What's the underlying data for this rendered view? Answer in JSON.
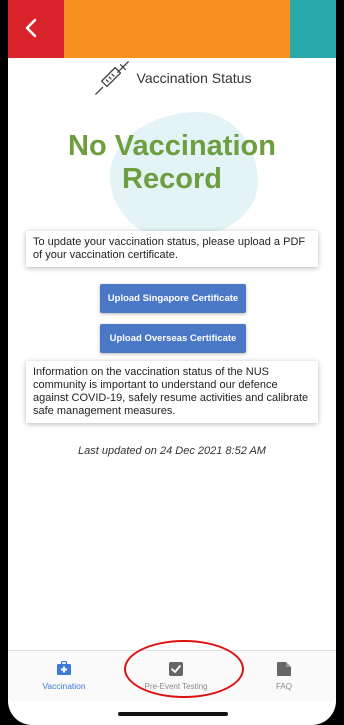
{
  "header": {
    "back_icon": "chevron-left-icon",
    "colors": {
      "left": "#d8232a",
      "middle": "#f7901e",
      "right": "#2aa9ad"
    }
  },
  "status": {
    "icon": "syringe-icon",
    "label": "Vaccination Status"
  },
  "record": {
    "title_line1": "No Vaccination",
    "title_line2": "Record",
    "title_color": "#6d9e3f"
  },
  "upload_info": "To update your vaccination status, please upload a PDF of your vaccination certificate.",
  "buttons": {
    "upload_singapore": "Upload Singapore Certificate",
    "upload_overseas": "Upload Overseas Certificate",
    "color": "#4a78c7"
  },
  "info_text": "Information on the vaccination status of the NUS community is important to understand our defence against COVID-19, safely resume activities and calibrate safe management measures.",
  "last_updated": "Last updated on 24 Dec 2021 8:52 AM",
  "nav": {
    "items": [
      {
        "label": "Vaccination",
        "icon": "medical-kit-icon",
        "active": true
      },
      {
        "label": "Pre-Event Testing",
        "icon": "checkbox-icon",
        "active": false
      },
      {
        "label": "FAQ",
        "icon": "document-icon",
        "active": false
      }
    ],
    "active_color": "#3a7bd5"
  }
}
